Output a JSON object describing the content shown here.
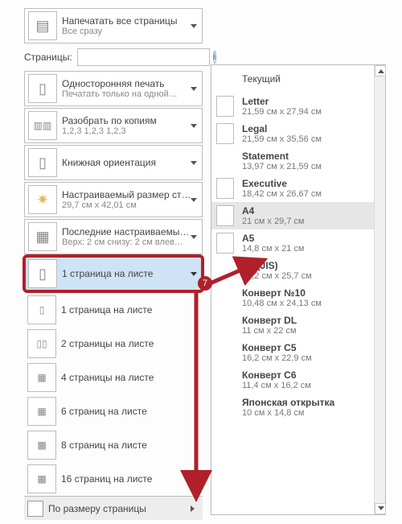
{
  "print_panel": {
    "print_all": {
      "title": "Напечатать все страницы",
      "sub": "Все сразу"
    },
    "pages_label": "Страницы:",
    "pages_value": "",
    "sides": {
      "title": "Односторонняя печать",
      "sub": "Печатать только на одной…"
    },
    "collate": {
      "title": "Разобрать по копиям",
      "sub": "1,2,3    1,2,3    1,2,3"
    },
    "orient": {
      "title": "Книжная ориентация",
      "sub": ""
    },
    "size": {
      "title": "Настраиваемый размер ст…",
      "sub": "29,7 см x 42,01 см"
    },
    "margins": {
      "title": "Последние настраиваемы…",
      "sub": "Верх: 2 см снизу: 2 см влев…"
    },
    "per_sheet_selected": "1 страница на листе",
    "per_sheet_options": [
      "1 страница на листе",
      "2 страницы на листе",
      "4 страницы на листе",
      "6 страниц на листе",
      "8 страниц на листе",
      "16 страниц на листе"
    ],
    "fit_to_page": "По размеру страницы"
  },
  "paper_sizes": [
    {
      "name": "Текущий",
      "dim": "",
      "current": true,
      "checkbox": false
    },
    {
      "name": "Letter",
      "dim": "21,59 см x 27,94 см",
      "checkbox": true
    },
    {
      "name": "Legal",
      "dim": "21,59 см x 35,56 см",
      "checkbox": true
    },
    {
      "name": "Statement",
      "dim": "13,97 см x 21,59 см",
      "checkbox": false
    },
    {
      "name": "Executive",
      "dim": "18,42 см x 26,67 см",
      "checkbox": true
    },
    {
      "name": "A4",
      "dim": "21 см x 29,7 см",
      "checkbox": true,
      "highlight": true
    },
    {
      "name": "A5",
      "dim": "14,8 см x 21 см",
      "checkbox": true
    },
    {
      "name": "B5 (JIS)",
      "dim": "18,2 см x 25,7 см",
      "checkbox": false
    },
    {
      "name": "Конверт №10",
      "dim": "10,48 см x 24,13 см",
      "checkbox": false
    },
    {
      "name": "Конверт DL",
      "dim": "11 см x 22 см",
      "checkbox": false
    },
    {
      "name": "Конверт C5",
      "dim": "16,2 см x 22,9 см",
      "checkbox": false
    },
    {
      "name": "Конверт C6",
      "dim": "11,4 см x 16,2 см",
      "checkbox": false
    },
    {
      "name": "Японская открытка",
      "dim": "10 см x 14,8 см",
      "checkbox": false
    }
  ],
  "annotation": {
    "badge": "7"
  }
}
